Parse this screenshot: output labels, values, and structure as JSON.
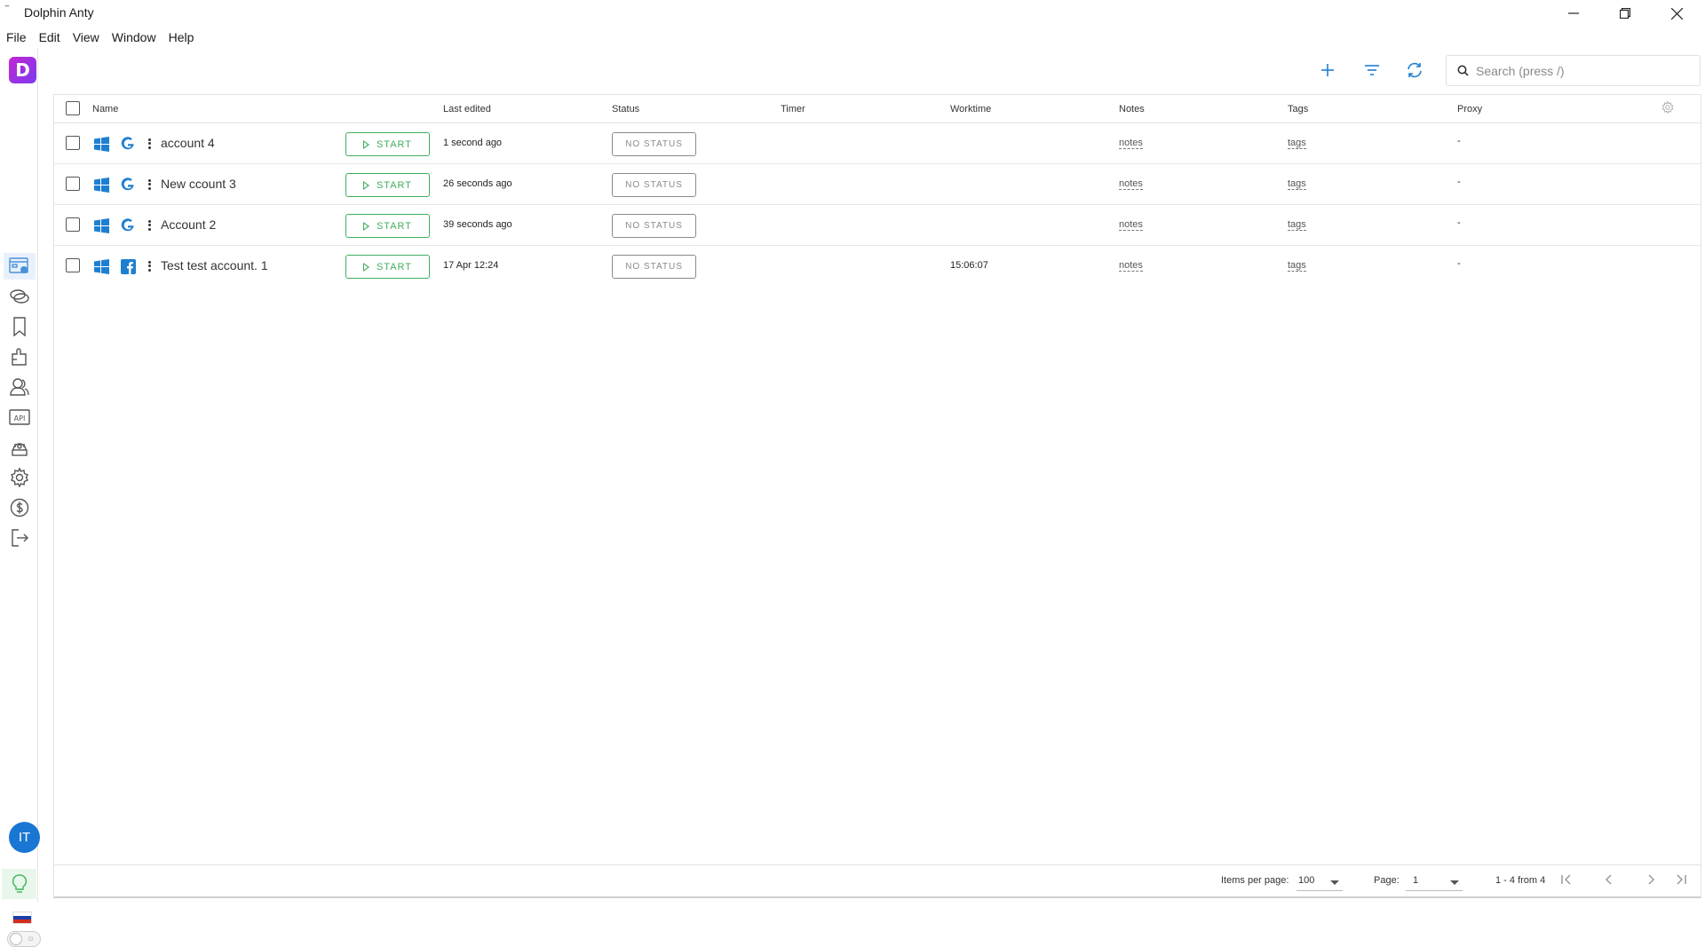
{
  "window": {
    "title": "Dolphin Anty",
    "app_glyph": "‾"
  },
  "menu": [
    "File",
    "Edit",
    "View",
    "Window",
    "Help"
  ],
  "logo": {
    "letter": "D"
  },
  "sidebar": {
    "items": [
      {
        "icon": "browser-profiles-icon",
        "active": true
      },
      {
        "icon": "proxies-icon"
      },
      {
        "icon": "bookmarks-icon"
      },
      {
        "icon": "extensions-icon"
      },
      {
        "icon": "users-icon"
      },
      {
        "icon": "api-icon"
      },
      {
        "icon": "cookie-robot-icon"
      },
      {
        "icon": "settings-icon"
      },
      {
        "icon": "billing-icon"
      },
      {
        "icon": "logout-icon"
      }
    ],
    "avatar_initials": "IT",
    "api_label": "API"
  },
  "toolbar": {
    "search_placeholder": "Search (press /)"
  },
  "table": {
    "headers": {
      "name": "Name",
      "last_edited": "Last edited",
      "status": "Status",
      "timer": "Timer",
      "worktime": "Worktime",
      "notes": "Notes",
      "tags": "Tags",
      "proxy": "Proxy"
    },
    "start_label": "START",
    "rows": [
      {
        "os": "windows-icon",
        "site": "google-icon",
        "name": "account 4",
        "last_edited": "1 second ago",
        "status": "NO STATUS",
        "timer": "",
        "worktime": "",
        "notes": "notes",
        "tags": "tags",
        "proxy": "-"
      },
      {
        "os": "windows-icon",
        "site": "google-icon",
        "name": "New ccount 3",
        "last_edited": "26 seconds ago",
        "status": "NO STATUS",
        "timer": "",
        "worktime": "",
        "notes": "notes",
        "tags": "tags",
        "proxy": "-"
      },
      {
        "os": "windows-icon",
        "site": "google-icon",
        "name": "Account 2",
        "last_edited": "39 seconds ago",
        "status": "NO STATUS",
        "timer": "",
        "worktime": "",
        "notes": "notes",
        "tags": "tags",
        "proxy": "-"
      },
      {
        "os": "windows-icon",
        "site": "facebook-icon",
        "name": "Test test account. 1",
        "last_edited": "17 Apr 12:24",
        "status": "NO STATUS",
        "timer": "",
        "worktime": "15:06:07",
        "notes": "notes",
        "tags": "tags",
        "proxy": "-"
      }
    ]
  },
  "footer": {
    "items_per_page_label": "Items per page:",
    "items_per_page_value": "100",
    "page_label": "Page:",
    "page_value": "1",
    "range_text": "1 - 4 from 4"
  },
  "colors": {
    "accent": "#1e7fd1",
    "start_green": "#3fae5f",
    "logo_gradient": [
      "#c026d3",
      "#7c3aed"
    ],
    "avatar": "#1976d2"
  }
}
